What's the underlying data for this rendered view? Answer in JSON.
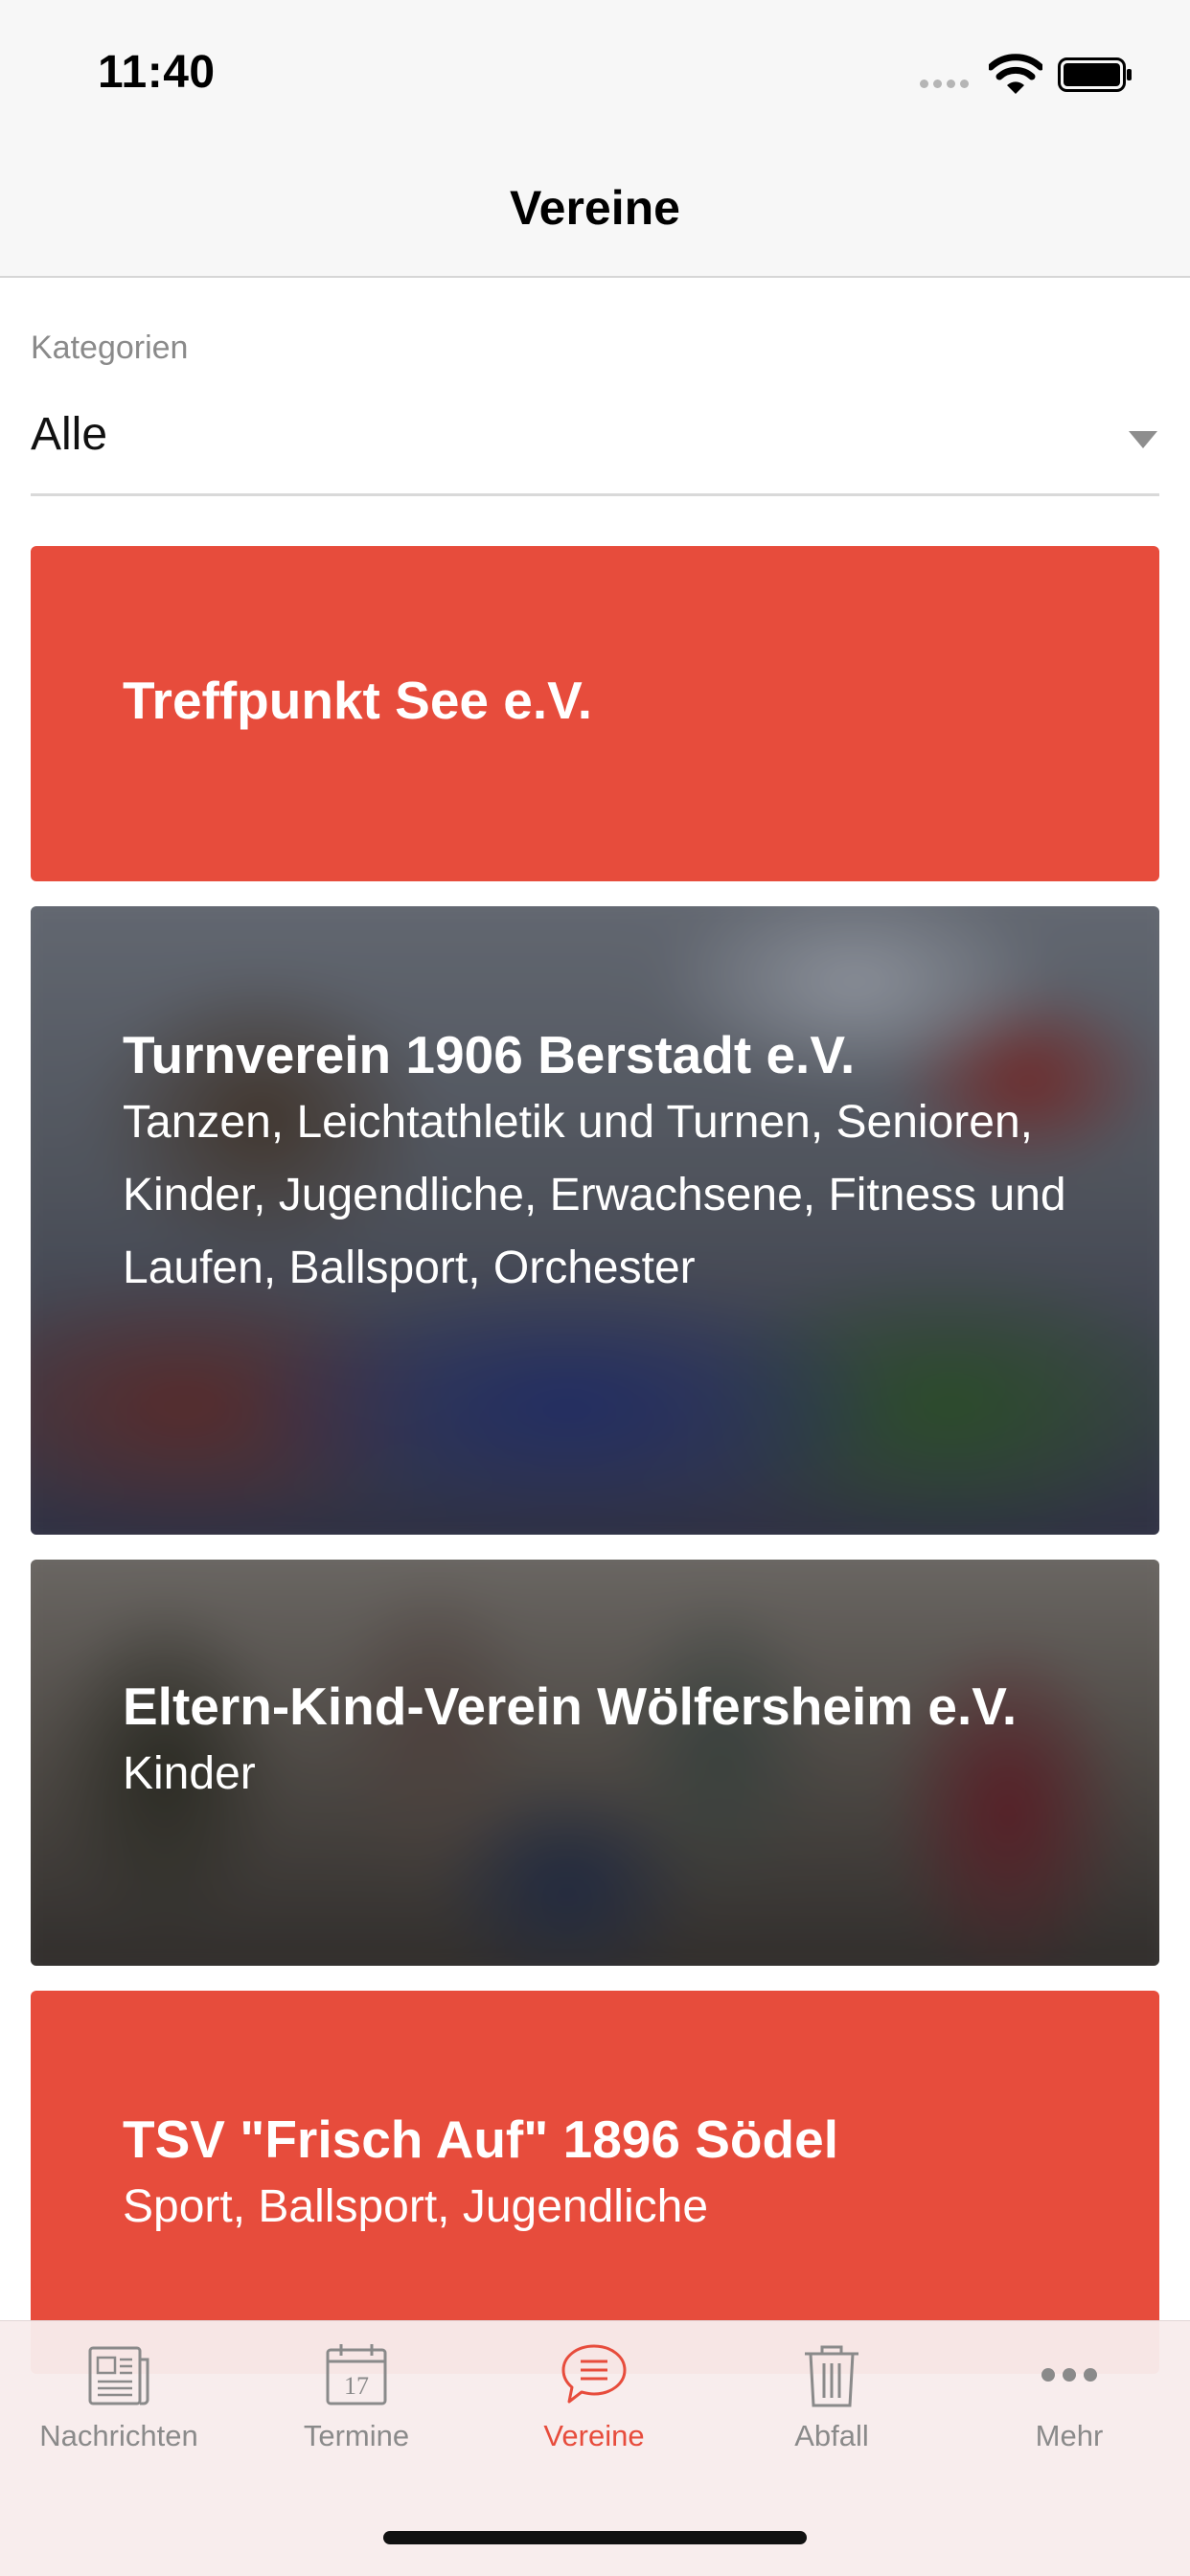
{
  "status_bar": {
    "time": "11:40"
  },
  "nav": {
    "title": "Vereine"
  },
  "category": {
    "label": "Kategorien",
    "value": "Alle"
  },
  "clubs": [
    {
      "name": "Treffpunkt See e.V.",
      "categories": "",
      "background": "#e74c3c"
    },
    {
      "name": "Turnverein 1906 Berstadt e.V.",
      "categories": "Tanzen, Leichtathletik und Turnen, Senioren, Kinder, Jugendliche, Erwachsene, Fitness und Laufen, Ballsport, Orchester",
      "background": "photo"
    },
    {
      "name": "Eltern-Kind-Verein Wölfersheim e.V.",
      "categories": "Kinder",
      "background": "photo"
    },
    {
      "name": "TSV \"Frisch Auf\" 1896 Södel",
      "categories": "Sport, Ballsport, Jugendliche",
      "background": "#e74c3c"
    }
  ],
  "tabs": [
    {
      "label": "Nachrichten",
      "icon": "newspaper-icon",
      "active": false
    },
    {
      "label": "Termine",
      "icon": "calendar-icon",
      "active": false
    },
    {
      "label": "Vereine",
      "icon": "chat-bubble-icon",
      "active": true
    },
    {
      "label": "Abfall",
      "icon": "trash-icon",
      "active": false
    },
    {
      "label": "Mehr",
      "icon": "more-dots-icon",
      "active": false
    }
  ],
  "calendar_icon_day": "17",
  "colors": {
    "accent": "#e74c3c",
    "inactive": "#8a8a8a"
  }
}
